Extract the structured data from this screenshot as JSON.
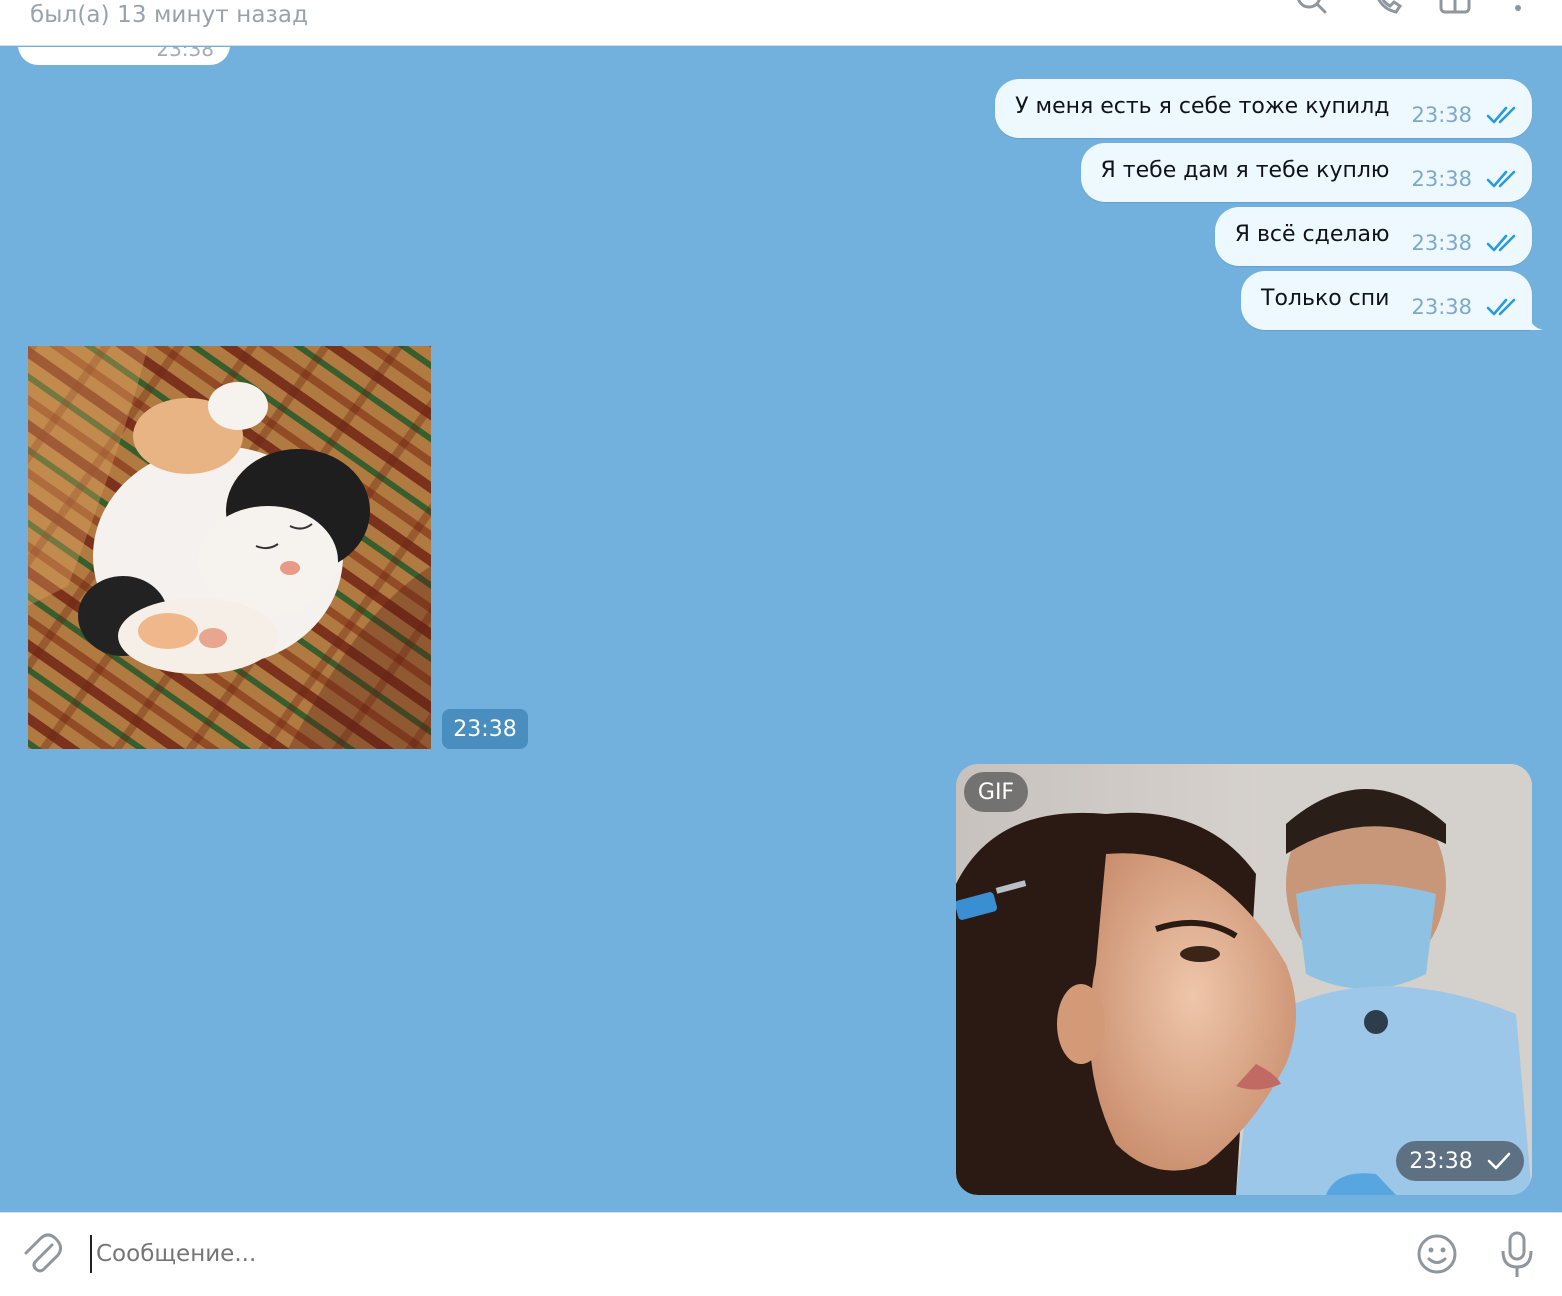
{
  "header": {
    "status": "был(а) 13 минут назад",
    "icons": [
      "search-icon",
      "phone-icon",
      "sidebar-toggle-icon",
      "more-vertical-icon"
    ]
  },
  "messages": {
    "partial_incoming_time": "23:38",
    "outgoing": [
      {
        "text": "У меня есть я себе тоже купилд",
        "time": "23:38",
        "status": "read"
      },
      {
        "text": "Я тебе дам я тебе куплю",
        "time": "23:38",
        "status": "read"
      },
      {
        "text": "Я всё сделаю",
        "time": "23:38",
        "status": "read"
      },
      {
        "text": "Только спи",
        "time": "23:38",
        "status": "read"
      }
    ],
    "photo": {
      "alt": "sleeping kitten on plaid blanket",
      "time": "23:38"
    },
    "gif": {
      "badge": "GIF",
      "time": "23:38",
      "status": "sent"
    }
  },
  "composer": {
    "placeholder": "Сообщение..."
  },
  "colors": {
    "chat_bg": "#72b1de",
    "bubble_out": "#eef8ff",
    "check_blue": "#2a9ae0"
  }
}
